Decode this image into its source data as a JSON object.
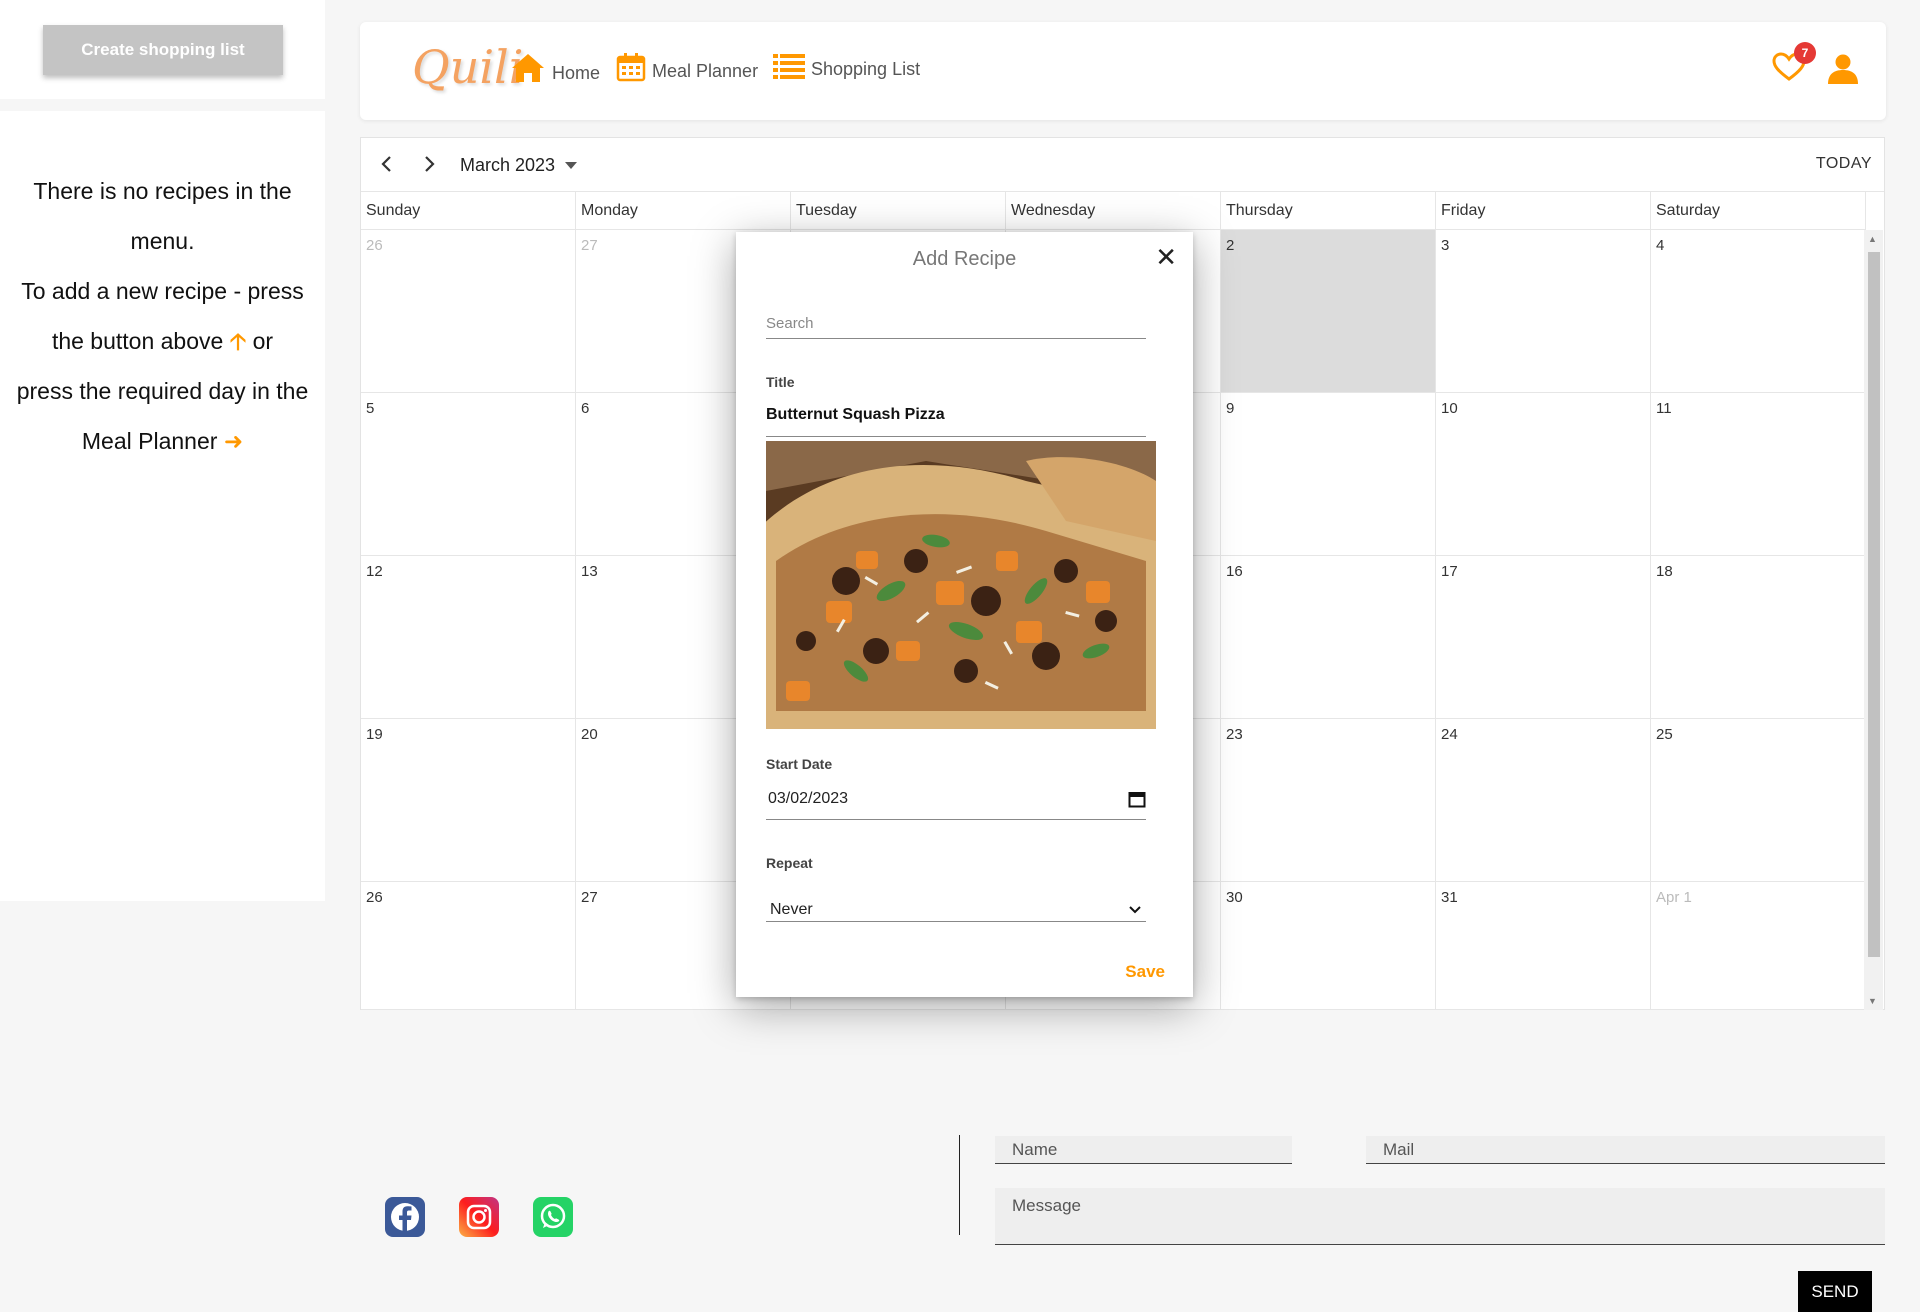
{
  "sidebar": {
    "create_button": "Create shopping list",
    "message": {
      "line1": "There is no recipes in the",
      "line2": "menu.",
      "line3": "To add a new recipe - press",
      "line4a": "the button above",
      "line4b": "or",
      "line5": "press the required day in the",
      "line6": "Meal Planner"
    }
  },
  "header": {
    "logo": "Quili",
    "nav": [
      {
        "label": "Home",
        "icon": "home-icon"
      },
      {
        "label": "Meal Planner",
        "icon": "calendar-icon"
      },
      {
        "label": "Shopping List",
        "icon": "list-icon"
      }
    ],
    "favorites_count": "7",
    "colors": {
      "accent": "#ff9800",
      "badge": "#e53935"
    }
  },
  "calendar": {
    "month": "March 2023",
    "today_label": "TODAY",
    "weekdays": [
      "Sunday",
      "Monday",
      "Tuesday",
      "Wednesday",
      "Thursday",
      "Friday",
      "Saturday"
    ],
    "weeks": [
      [
        "26",
        "27",
        "",
        "",
        "2",
        "3",
        "4"
      ],
      [
        "5",
        "6",
        "",
        "",
        "9",
        "10",
        "11"
      ],
      [
        "12",
        "13",
        "",
        "",
        "16",
        "17",
        "18"
      ],
      [
        "19",
        "20",
        "",
        "",
        "23",
        "24",
        "25"
      ],
      [
        "26",
        "27",
        "",
        "",
        "30",
        "31",
        "Apr 1"
      ]
    ]
  },
  "modal": {
    "title": "Add Recipe",
    "search_placeholder": "Search",
    "title_label": "Title",
    "title_value": "Butternut Squash Pizza",
    "start_date_label": "Start Date",
    "start_date_value": "03/02/2023",
    "repeat_label": "Repeat",
    "repeat_value": "Never",
    "save_label": "Save"
  },
  "footer": {
    "name_placeholder": "Name",
    "mail_placeholder": "Mail",
    "message_placeholder": "Message",
    "send_label": "SEND",
    "social": [
      "facebook-icon",
      "instagram-icon",
      "whatsapp-icon"
    ]
  }
}
